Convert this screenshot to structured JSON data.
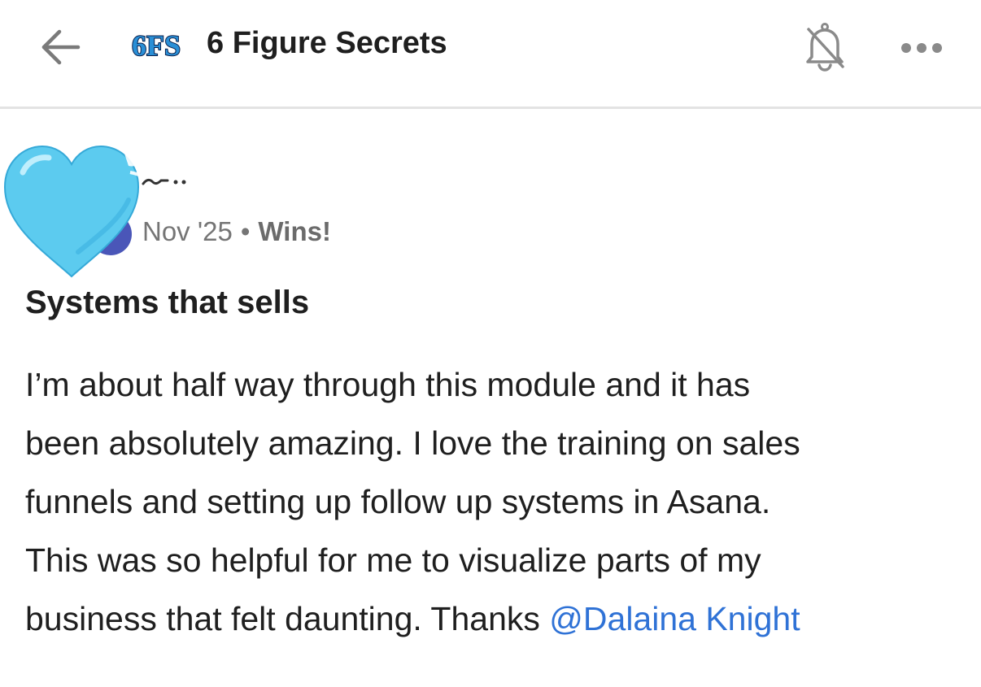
{
  "header": {
    "back_icon": "arrow-left-icon",
    "logo_text": "6FS",
    "group_name": "6 Figure Secrets",
    "bell_icon": "bell-off-icon",
    "more_icon": "more-horizontal-icon"
  },
  "post": {
    "avatar_icon": "blue-heart-emoji",
    "date": "Nov '25",
    "separator": "•",
    "category": "Wins!",
    "title": "Systems that sells",
    "body_lines": [
      "I’m about half way through this module and it has",
      "been absolutely amazing. I love the training on sales",
      "funnels and setting up follow up systems in Asana.",
      "This was so helpful for me to visualize parts of my",
      "business that felt daunting. Thanks "
    ],
    "mention": "@Dalaina Knight"
  },
  "colors": {
    "accent_link": "#2f72d6",
    "heart": "#5ccbef",
    "avatar_badge": "#4a56b8",
    "divider": "#e3e3e3",
    "meta_text": "#757575"
  }
}
